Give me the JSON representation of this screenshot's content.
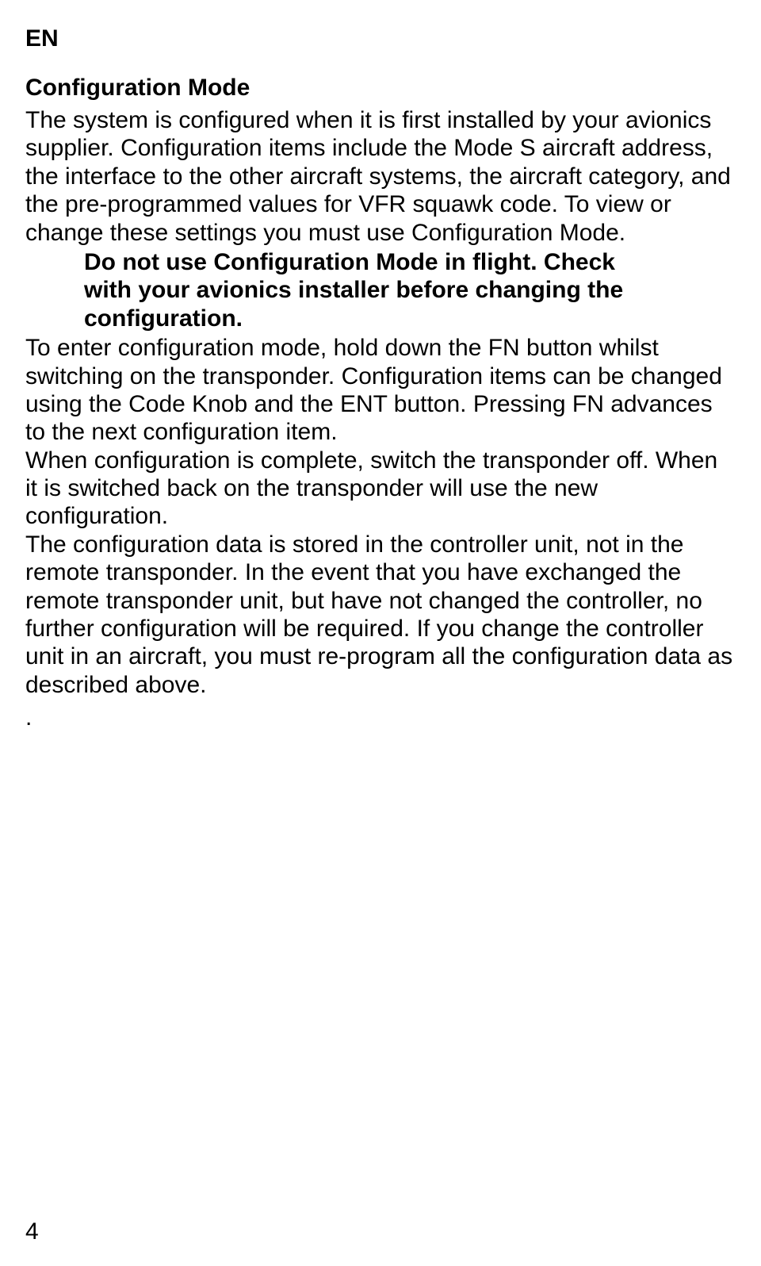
{
  "lang": "EN",
  "heading": "Configuration Mode",
  "p1": "The system is configured when it is first installed by your avionics supplier.  Configuration items include the Mode S aircraft address, the interface to the other aircraft systems, the aircraft category, and the pre-programmed values for VFR squawk code.  To view or change these settings you must use Configuration Mode.",
  "warning": "Do not use Configuration Mode in flight.  Check with your avionics installer before changing the configuration.",
  "p2": "To enter configuration mode, hold down the FN button whilst switching on the transponder.  Configuration items can be changed using the Code Knob and the ENT button.  Pressing FN advances to the next configuration item.",
  "p3": "When configuration is complete, switch the transponder off.  When it is switched back on the transponder will use the new configuration.",
  "p4": "The configuration data is stored in the controller unit, not in the remote transponder.  In the event that you have exchanged the remote transponder unit, but have not changed the controller, no further configuration will be required.  If you change the controller unit in an aircraft, you must re-program all the configuration data as described above.",
  "dot": ".",
  "page_number": "4"
}
